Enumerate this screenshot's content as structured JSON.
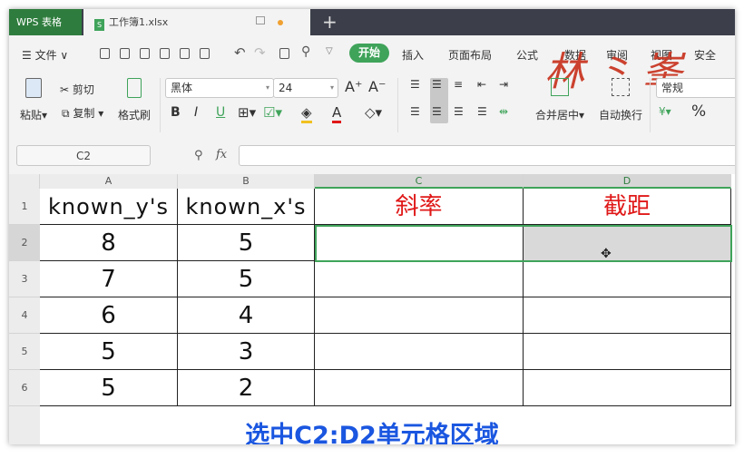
{
  "tabbar": {
    "app_label": "WPS 表格",
    "doc_icon": "S",
    "doc_name": "工作簿1.xlsx",
    "new_tab": "+"
  },
  "menu": {
    "file": "☰ 文件 ∨",
    "tabs": [
      "开始",
      "插入",
      "页面布局",
      "公式",
      "数据",
      "审阅",
      "视图",
      "安全"
    ],
    "active_tab": "开始"
  },
  "logo_text": "林之峯",
  "ribbon": {
    "paste": "粘贴▾",
    "cut": "✂ 剪切",
    "copy": "复制 ▾",
    "format_painter": "格式刷",
    "font_name": "黑体",
    "font_size": "24",
    "bold": "B",
    "italic": "I",
    "underline": "U",
    "merge": "合并居中▾",
    "wrap": "自动换行",
    "number_format": "常规",
    "currency": "¥▾",
    "percent": "%"
  },
  "formula_bar": {
    "name_box": "C2",
    "fx": "fx",
    "formula": ""
  },
  "sheet": {
    "columns": [
      "A",
      "B",
      "C",
      "D"
    ],
    "rows": [
      "1",
      "2",
      "3",
      "4",
      "5",
      "6"
    ],
    "cells": [
      [
        "known_y's",
        "known_x's",
        "斜率",
        "截距"
      ],
      [
        "8",
        "5",
        "",
        ""
      ],
      [
        "7",
        "5",
        "",
        ""
      ],
      [
        "6",
        "4",
        "",
        ""
      ],
      [
        "5",
        "3",
        "",
        ""
      ],
      [
        "5",
        "2",
        "",
        ""
      ]
    ]
  },
  "caption": "选中C2:D2单元格区域",
  "colors": {
    "accent": "#3fa35a",
    "header_red": "#e01818",
    "caption_blue": "#1a56e0"
  }
}
